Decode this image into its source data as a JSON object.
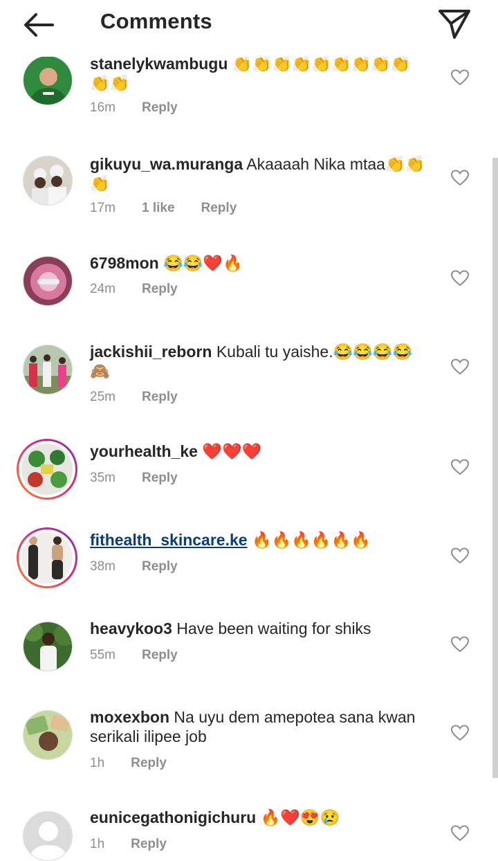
{
  "header": {
    "title": "Comments"
  },
  "comments": [
    {
      "username": "stanelykwambugu",
      "text": "👏👏👏👏👏👏👏👏👏👏👏",
      "time": "16m",
      "likes": "",
      "reply": "Reply"
    },
    {
      "username": "gikuyu_wa.muranga",
      "text": "Akaaaah Nika mtaa👏👏👏",
      "time": "17m",
      "likes": "1 like",
      "reply": "Reply"
    },
    {
      "username": "6798mon",
      "text": "😂😂❤️🔥",
      "time": "24m",
      "likes": "",
      "reply": "Reply"
    },
    {
      "username": "jackishii_reborn",
      "text": "Kubali tu yaishe.😂😂😂😂🙈",
      "time": "25m",
      "likes": "",
      "reply": "Reply"
    },
    {
      "username": "yourhealth_ke",
      "text": "❤️❤️❤️",
      "time": "35m",
      "likes": "",
      "reply": "Reply"
    },
    {
      "username": "fithealth_skincare.ke",
      "text": "🔥🔥🔥🔥🔥🔥",
      "time": "38m",
      "likes": "",
      "reply": "Reply"
    },
    {
      "username": "heavykoo3",
      "text": "Have been waiting for shiks",
      "time": "55m",
      "likes": "",
      "reply": "Reply"
    },
    {
      "username": "moxexbon",
      "text": "Na uyu dem amepotea sana kwan serikali ilipee job",
      "time": "1h",
      "likes": "",
      "reply": "Reply"
    },
    {
      "username": "eunicegathonigichuru",
      "text": "🔥❤️😍😢",
      "time": "1h",
      "likes": "",
      "reply": "Reply"
    }
  ]
}
